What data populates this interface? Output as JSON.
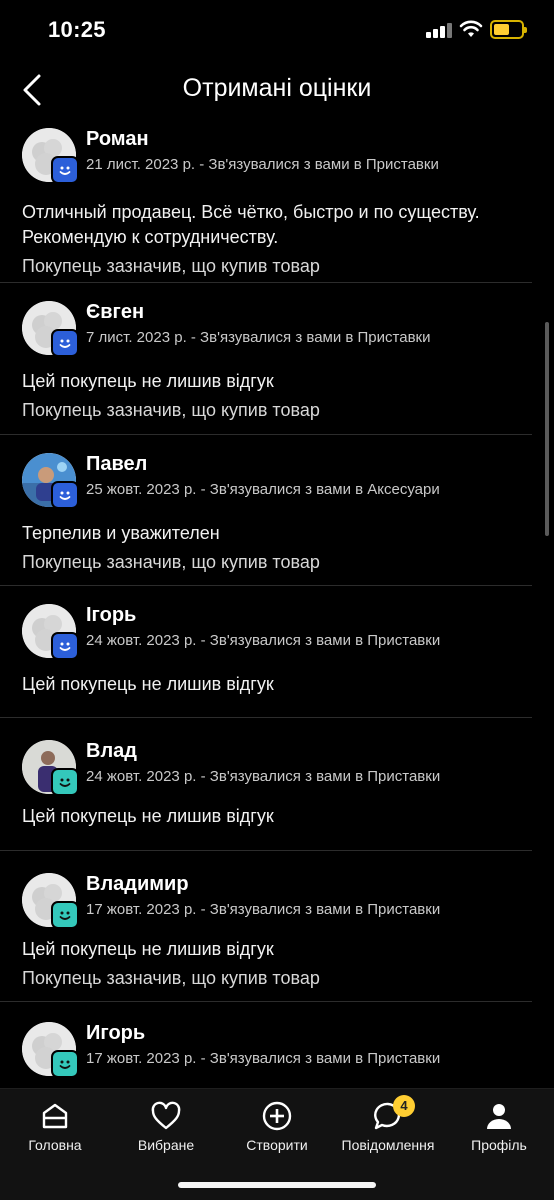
{
  "status": {
    "time": "10:25"
  },
  "header": {
    "title": "Отримані оцінки"
  },
  "reviews": [
    {
      "name": "Роман",
      "meta": "21 лист. 2023 р. - Зв'язувалися з вами в Приставки",
      "comment": "Отличный продавец. Всё чётко, быстро и по существу. Рекомендую к сотрудничеству.",
      "purchase": "Покупець зазначив, що купив товар"
    },
    {
      "name": "Євген",
      "meta": "7 лист. 2023 р. - Зв'язувалися з вами в Приставки",
      "comment": "Цей покупець не лишив відгук",
      "purchase": "Покупець зазначив, що купив товар"
    },
    {
      "name": "Павел",
      "meta": "25 жовт. 2023 р. - Зв'язувалися з вами в Аксесуари",
      "comment": "Терпелив и уважителен",
      "purchase": "Покупець зазначив, що купив товар"
    },
    {
      "name": "Ігорь",
      "meta": "24 жовт. 2023 р. - Зв'язувалися з вами в Приставки",
      "comment": "Цей покупець не лишив відгук"
    },
    {
      "name": "Влад",
      "meta": "24 жовт. 2023 р. - Зв'язувалися з вами в Приставки",
      "comment": "Цей покупець не лишив відгук"
    },
    {
      "name": "Владимир",
      "meta": "17 жовт. 2023 р. - Зв'язувалися з вами в Приставки",
      "comment": "Цей покупець не лишив відгук",
      "purchase": "Покупець зазначив, що купив товар"
    },
    {
      "name": "Игорь",
      "meta": "17 жовт. 2023 р. - Зв'язувалися з вами в Приставки"
    }
  ],
  "nav": {
    "home": "Головна",
    "favorites": "Вибране",
    "create": "Створити",
    "messages": "Повідомлення",
    "messages_badge": "4",
    "profile": "Профіль"
  },
  "colors": {
    "accent": "#ffce32",
    "badge_blue": "#2c5fd9",
    "badge_teal": "#34c8bb"
  }
}
